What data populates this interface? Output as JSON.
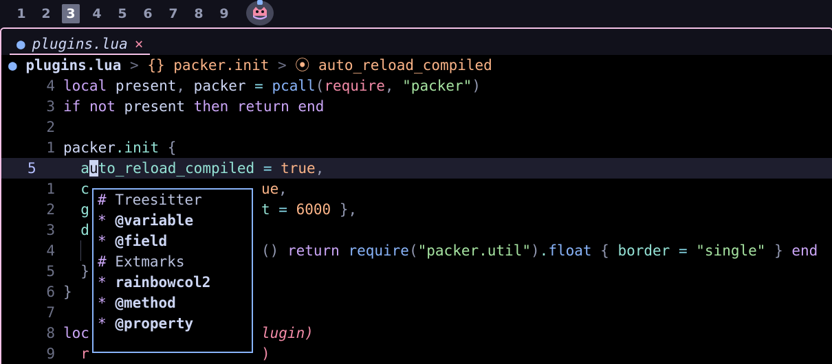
{
  "workspaces": [
    "1",
    "2",
    "3",
    "4",
    "5",
    "6",
    "7",
    "8",
    "9"
  ],
  "active_workspace": "3",
  "tab": {
    "icon": "lua-icon",
    "filename": "plugins.lua",
    "close": "×"
  },
  "winbar": {
    "file_icon": "lua-icon",
    "file": "plugins.lua",
    "sep1": " > ",
    "scope_icon": "{}",
    "scope": "packer.init",
    "sep2": " > ",
    "field_icon": "⦿",
    "field": "auto_reload_compiled"
  },
  "gutter": [
    "4",
    "3",
    "2",
    "1",
    "5",
    "1",
    "2",
    "3",
    "4",
    "5",
    "6",
    "7",
    "8",
    "9"
  ],
  "code": {
    "l1": {
      "a": "local ",
      "b": "present",
      "c": ", ",
      "d": "packer",
      "e": " = ",
      "f": "pcall",
      "g": "(",
      "h": "require",
      "i": ", ",
      "j": "\"packer\"",
      "k": ")"
    },
    "l2": {
      "a": "if ",
      "b": "not ",
      "c": "present ",
      "d": "then ",
      "e": "return ",
      "f": "end"
    },
    "l4": {
      "a": "packer",
      "b": ".",
      "c": "init",
      "d": " {"
    },
    "l5": {
      "a": "a",
      "b": "u",
      "c": "to_reload_compiled",
      "d": " = ",
      "e": "true",
      "f": ","
    },
    "l6": {
      "a": "c",
      "b": "ue",
      "c": ","
    },
    "l7": {
      "a": "g",
      "b": "t",
      "c": " = ",
      "d": "6000",
      "e": " }",
      "f": ","
    },
    "l8": {
      "a": "d"
    },
    "l9": {
      "b": "() ",
      "c": "return ",
      "d": "require",
      "e": "(",
      "f": "\"packer.util\"",
      "g": ")",
      "h": ".",
      "i": "float",
      "j": " { ",
      "k": "border",
      "l": " = ",
      "m": "\"single\"",
      "n": " } ",
      "o": "end"
    },
    "l10": {
      "a": "}"
    },
    "l11": {
      "a": "}"
    },
    "l13": {
      "a": "loc",
      "b": "lugin)"
    },
    "l14": {
      "a": "r",
      "b": ")"
    }
  },
  "popup": {
    "items": [
      {
        "mark": "#",
        "label": "Treesitter",
        "kind": "header"
      },
      {
        "mark": "*",
        "label": "@variable",
        "kind": "item"
      },
      {
        "mark": "*",
        "label": "@field",
        "kind": "item"
      },
      {
        "mark": "#",
        "label": "Extmarks",
        "kind": "header"
      },
      {
        "mark": "*",
        "label": "rainbowcol2",
        "kind": "item"
      },
      {
        "mark": "*",
        "label": "@method",
        "kind": "item"
      },
      {
        "mark": "*",
        "label": "@property",
        "kind": "item"
      }
    ]
  },
  "colors": {
    "accent": "#f5c2e7",
    "popup_border": "#89b4fa",
    "background": "#000000"
  }
}
